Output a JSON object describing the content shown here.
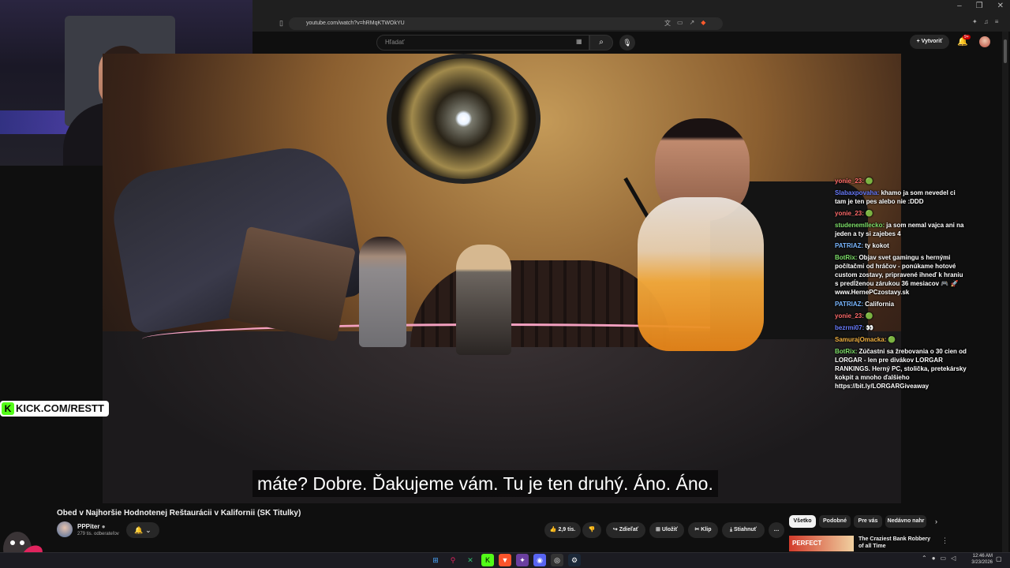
{
  "browser": {
    "url": "youtube.com/watch?v=hRMqKTWOkYU",
    "window_controls": [
      "–",
      "❐",
      "✕"
    ]
  },
  "youtube": {
    "search_placeholder": "Hľadať",
    "create_label": "Vytvoriť",
    "notification_badge": "9+"
  },
  "overlay": {
    "kick_text": "KICK.COM/RESTT",
    "kick_logo": "K"
  },
  "video": {
    "subtitle": "máte? Dobre. Ďakujeme vám. Tu je ten druhý. Áno. Áno."
  },
  "chat": [
    {
      "user": "yonie_23:",
      "color": "#ff6b6b",
      "text": "🟢"
    },
    {
      "user": "Slabaxpovaha:",
      "color": "#6a7dff",
      "text": "khamo ja som nevedel ci tam je ten pes alebo nie :DDD"
    },
    {
      "user": "yonie_23:",
      "color": "#ff6b6b",
      "text": "🟢"
    },
    {
      "user": "studenemlIecko:",
      "color": "#7ee06a",
      "text": "ja som nemal vajca ani na jeden a ty si zajebes 4"
    },
    {
      "user": "PATRIAZ:",
      "color": "#7ab7ff",
      "text": "ty kokot"
    },
    {
      "user": "BotRix:",
      "color": "#7ee06a",
      "text": "Objav svet gamingu s hernými počítačmi od hráčov - ponúkame hotové custom zostavy, pripravené ihneď k hraniu s predĺženou zárukou 36 mesiacov 🎮 🚀 www.HernePCzostavy.sk"
    },
    {
      "user": "PATRIAZ:",
      "color": "#7ab7ff",
      "text": "California"
    },
    {
      "user": "yonie_23:",
      "color": "#ff6b6b",
      "text": "🟢"
    },
    {
      "user": "bezrmi07:",
      "color": "#6a7dff",
      "text": "👀"
    },
    {
      "user": "SamurajOmacka:",
      "color": "#f0b040",
      "text": "🟢"
    },
    {
      "user": "BotRix:",
      "color": "#7ee06a",
      "text": "Zúčastni sa žrebovania o 30 cien od LORGAR - len pre divákov LORGAR RANKINGS. Herný PC, stolička, pretekársky kokpit a mnoho ďalšieho https://bit.ly/LORGARGiveaway"
    }
  ],
  "details": {
    "title": "Obed v Najhoršie Hodnotenej Reštaurácii v Kalifornii (SK Titulky)",
    "channel": "PPPiter",
    "subscribers": "279 tis. odberateľov",
    "likes": "2,9 tis.",
    "share": "Zdieľať",
    "save": "Uložiť",
    "clip": "Klip",
    "download": "Stiahnuť",
    "more": "…"
  },
  "chips": [
    "Všetko",
    "Podobné",
    "Pre vás",
    "Nedávno nahr"
  ],
  "recommendation": {
    "thumb_text": "PERFECT",
    "title": "The Craziest Bank Robbery of all Time"
  },
  "taskbar": {
    "time": "12:46 AM",
    "date": "3/23/2026"
  }
}
